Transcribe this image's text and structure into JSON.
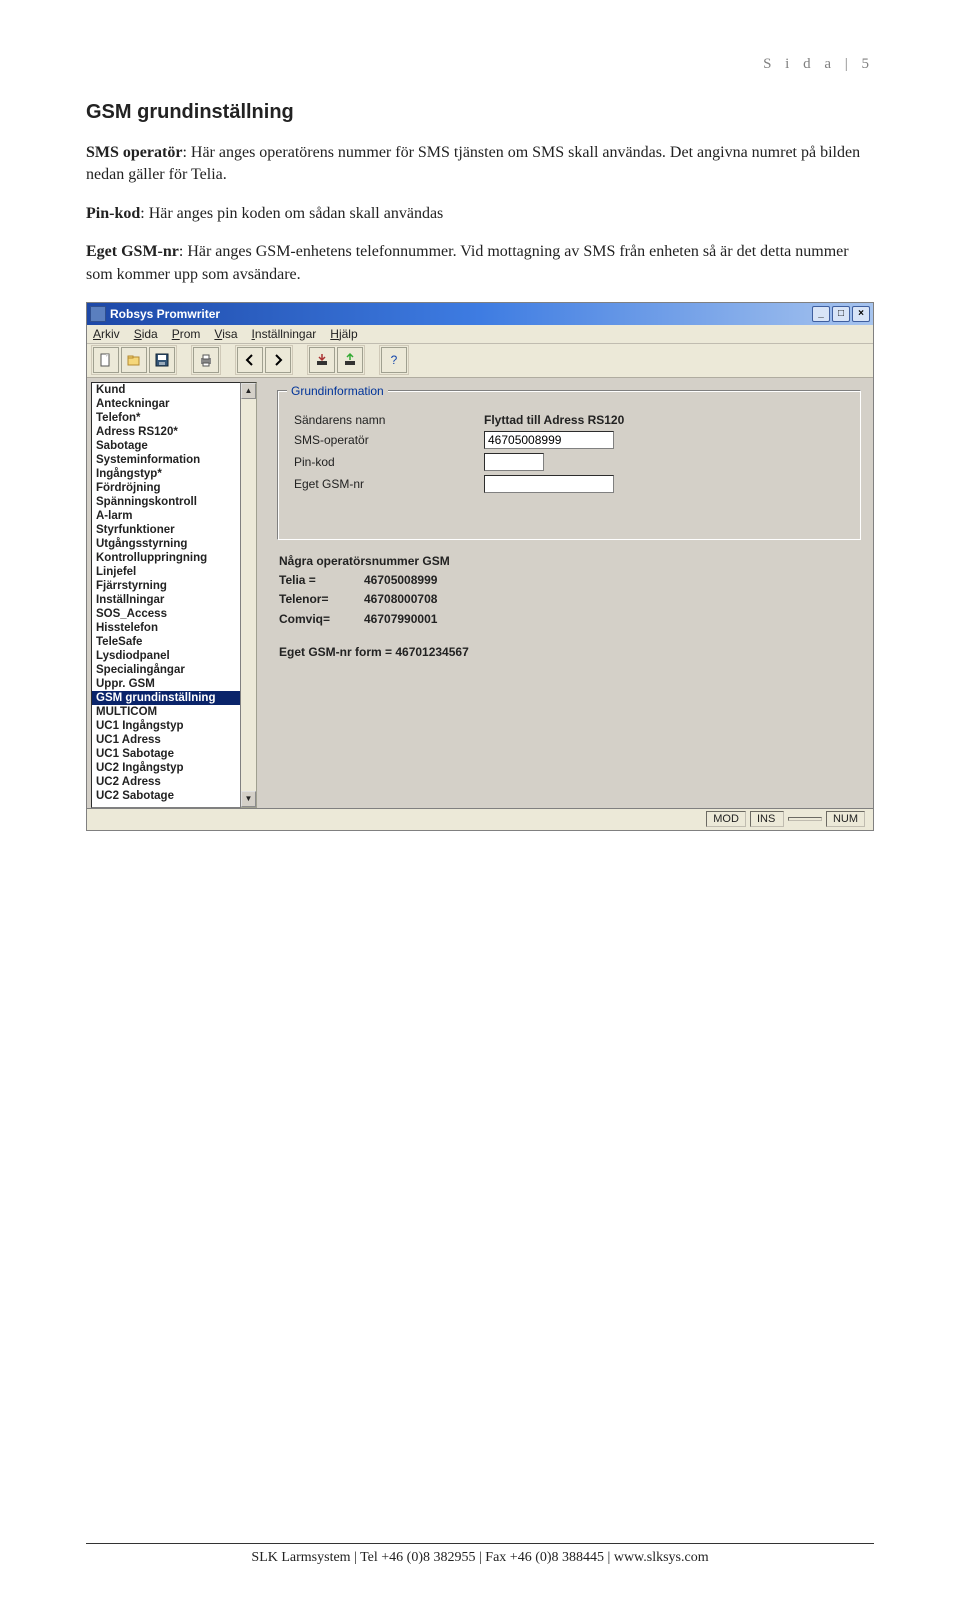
{
  "page_header": "S i d a  | 5",
  "heading": "GSM grundinställning",
  "paragraphs": {
    "p1_strong": "SMS operatör",
    "p1_rest": ": Här anges operatörens nummer för SMS tjänsten om SMS skall användas. Det angivna numret på bilden nedan gäller för Telia.",
    "p2_strong": "Pin-kod",
    "p2_rest": ": Här anges pin koden om sådan skall användas",
    "p3_strong": "Eget GSM-nr",
    "p3_rest": ": Här anges GSM-enhetens telefonnummer. Vid mottagning av SMS från enheten så är det detta nummer som kommer upp som avsändare."
  },
  "window": {
    "title": "Robsys Promwriter",
    "menus": [
      "Arkiv",
      "Sida",
      "Prom",
      "Visa",
      "Inställningar",
      "Hjälp"
    ],
    "status_cells": [
      "MOD",
      "INS",
      "",
      "NUM"
    ]
  },
  "sidebar_items": [
    "Kund",
    "Anteckningar",
    "Telefon*",
    "Adress RS120*",
    "Sabotage",
    "Systeminformation",
    "Ingångstyp*",
    "Fördröjning",
    "Spänningskontroll",
    "A-larm",
    "Styrfunktioner",
    "Utgångsstyrning",
    "Kontrolluppringning",
    "Linjefel",
    "Fjärrstyrning",
    "Inställningar",
    "SOS_Access",
    "Hisstelefon",
    "TeleSafe",
    "Lysdiodpanel",
    "Specialingångar",
    "Uppr. GSM",
    "GSM grundinställning",
    "MULTICOM",
    "UC1 Ingångstyp",
    "UC1 Adress",
    "UC1 Sabotage",
    "UC2 Ingångstyp",
    "UC2 Adress",
    "UC2 Sabotage"
  ],
  "sidebar_selected_index": 22,
  "form": {
    "group_title": "Grundinformation",
    "fields": {
      "sender_name_label": "Sändarens namn",
      "sender_name_value": "Flyttad till Adress RS120",
      "sms_operator_label": "SMS-operatör",
      "sms_operator_value": "46705008999",
      "pin_label": "Pin-kod",
      "pin_value": "",
      "own_gsm_label": "Eget GSM-nr",
      "own_gsm_value": ""
    },
    "notes": {
      "heading": "Några operatörsnummer GSM",
      "ops": [
        {
          "name": "Telia =",
          "number": "46705008999"
        },
        {
          "name": "Telenor=",
          "number": "46708000708"
        },
        {
          "name": "Comviq=",
          "number": "46707990001"
        }
      ],
      "example": "Eget GSM-nr form = 46701234567"
    }
  },
  "footer": "SLK Larmsystem | Tel +46 (0)8 382955 | Fax +46 (0)8 388445 | www.slksys.com"
}
